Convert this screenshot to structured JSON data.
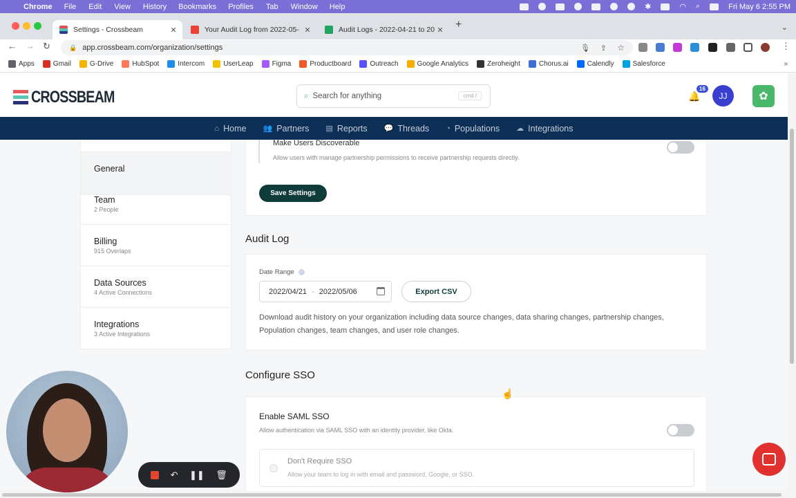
{
  "menubar": {
    "app": "Chrome",
    "items": [
      "File",
      "Edit",
      "View",
      "History",
      "Bookmarks",
      "Profiles",
      "Tab",
      "Window",
      "Help"
    ],
    "clock": "Fri May 6  2:55 PM"
  },
  "tabs": [
    {
      "title": "Settings - Crossbeam",
      "close": "✕"
    },
    {
      "title": "Your Audit Log from 2022-05-",
      "close": "✕"
    },
    {
      "title": "Audit Logs - 2022-04-21 to 20",
      "close": "✕"
    }
  ],
  "new_tab": "+",
  "url": "app.crossbeam.com/organization/settings",
  "bookmarks": [
    {
      "label": "Apps",
      "color": "#5f6368"
    },
    {
      "label": "Gmail",
      "color": "#d93025"
    },
    {
      "label": "G-Drive",
      "color": "#f4b400"
    },
    {
      "label": "HubSpot",
      "color": "#ff7a59"
    },
    {
      "label": "Intercom",
      "color": "#1f8ded"
    },
    {
      "label": "UserLeap",
      "color": "#f2c200"
    },
    {
      "label": "Figma",
      "color": "#a259ff"
    },
    {
      "label": "Productboard",
      "color": "#f05a28"
    },
    {
      "label": "Outreach",
      "color": "#5951ff"
    },
    {
      "label": "Google Analytics",
      "color": "#f9ab00"
    },
    {
      "label": "Zeroheight",
      "color": "#333333"
    },
    {
      "label": "Chorus.ai",
      "color": "#3c6fd8"
    },
    {
      "label": "Calendly",
      "color": "#006bff"
    },
    {
      "label": "Salesforce",
      "color": "#00a1e0"
    }
  ],
  "bookmarks_more": "»",
  "app": {
    "logo_text": "CROSSBEAM",
    "search_placeholder": "Search for anything",
    "search_shortcut": "cmd /",
    "notification_count": "16",
    "avatar_initials": "JJ"
  },
  "nav": [
    {
      "label": "Home",
      "icon": "⌂"
    },
    {
      "label": "Partners",
      "icon": "👥"
    },
    {
      "label": "Reports",
      "icon": "▤"
    },
    {
      "label": "Threads",
      "icon": "💬"
    },
    {
      "label": "Populations",
      "icon": "◔"
    },
    {
      "label": "Integrations",
      "icon": "☁"
    }
  ],
  "sidebar": [
    {
      "title": "General",
      "sub": ""
    },
    {
      "title": "Team",
      "sub": "2 People"
    },
    {
      "title": "Billing",
      "sub": "915 Overlaps"
    },
    {
      "title": "Data Sources",
      "sub": "4 Active Connections"
    },
    {
      "title": "Integrations",
      "sub": "3 Active Integrations"
    }
  ],
  "discoverable": {
    "title": "Make Users Discoverable",
    "desc": "Allow users with manage partnership permissions to receive partnership requests directly.",
    "enabled": false
  },
  "save_button": "Save Settings",
  "audit": {
    "heading": "Audit Log",
    "date_label": "Date Range",
    "date_start": "2022/04/21",
    "date_sep": "-",
    "date_end": "2022/05/06",
    "export_button": "Export CSV",
    "desc": "Download audit history on your organization including data source changes, data sharing changes, partnership changes, Population changes, team changes, and user role changes."
  },
  "sso": {
    "heading": "Configure SSO",
    "title": "Enable SAML SSO",
    "desc": "Allow authentication via SAML SSO with an identity provider, like Okta.",
    "enabled": false,
    "option_title": "Don't Require SSO",
    "option_desc": "Allow your team to log in with email and password, Google, or SSO."
  }
}
